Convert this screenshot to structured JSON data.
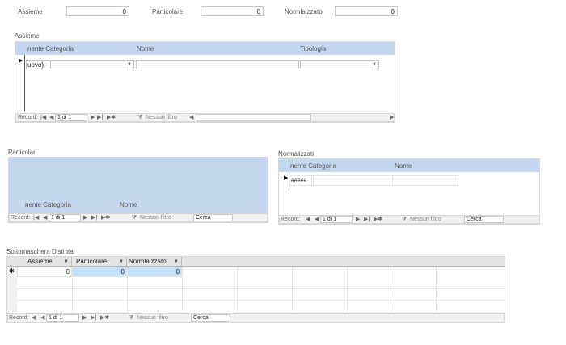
{
  "top": {
    "assieme_label": "Assieme",
    "assieme_value": "0",
    "particolare_label": "Particolare",
    "particolare_value": "0",
    "normalizzato_label": "Normlaizzato",
    "normalizzato_value": "0"
  },
  "assieme": {
    "title": "Assieme",
    "col_categoria": "nente Categoria",
    "col_nome": "Nome",
    "col_tipologia": "Tipologia",
    "row_first": "uovo)",
    "nav": {
      "record_label": "Record:",
      "position": "1 di 1",
      "filter": "Nessun filtro"
    }
  },
  "particolari": {
    "title": "Particolari",
    "col_categoria": "nente Categoria",
    "col_nome": "Nome",
    "nav": {
      "record_label": "Record:",
      "position": "1 di 1",
      "filter": "Nessun filtro",
      "search": "Cerca"
    }
  },
  "normalizzati": {
    "title": "Normalizzati",
    "col_categoria": "nente Categoria",
    "col_nome": "Nome",
    "row_first": "#####",
    "nav": {
      "record_label": "Record:",
      "position": "1 di 1",
      "filter": "Nessun filtro",
      "search": "Cerca"
    }
  },
  "distinta": {
    "title": "Sottomaschera Distinta",
    "headers": [
      "Assieme",
      "Particolare",
      "Normlaizzato"
    ],
    "row": [
      "0",
      "0",
      "0"
    ],
    "new_row_marker": "✱",
    "nav": {
      "record_label": "Record:",
      "position": "1 di 1",
      "filter": "Nessun filtro",
      "search": "Cerca"
    }
  }
}
